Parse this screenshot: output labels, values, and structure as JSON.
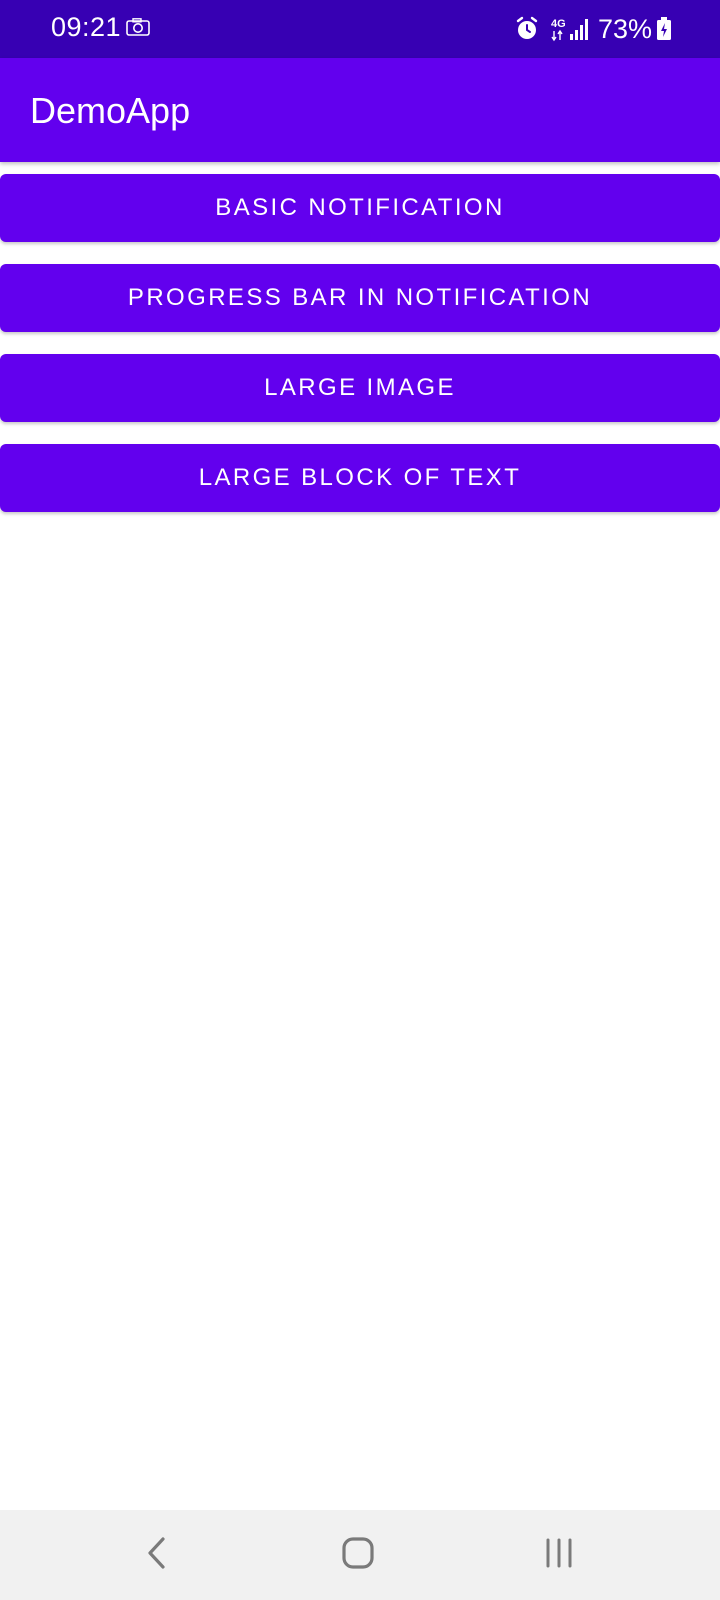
{
  "status_bar": {
    "time": "09:21",
    "battery_percent": "73%",
    "network_label": "4G",
    "icons": [
      "camera-icon",
      "alarm-icon",
      "signal-icon",
      "battery-charging-icon"
    ],
    "background": "#3700b3"
  },
  "app_bar": {
    "title": "DemoApp",
    "background": "#6200ee"
  },
  "buttons": [
    {
      "label": "BASIC NOTIFICATION"
    },
    {
      "label": "PROGRESS BAR IN NOTIFICATION"
    },
    {
      "label": "LARGE IMAGE"
    },
    {
      "label": "LARGE BLOCK OF TEXT"
    }
  ],
  "nav_bar": {
    "icons": [
      "back-icon",
      "home-icon",
      "recents-icon"
    ],
    "background": "#f1f1f1"
  },
  "colors": {
    "accent": "#6200ee",
    "status": "#3700b3",
    "on_accent": "#ffffff"
  }
}
